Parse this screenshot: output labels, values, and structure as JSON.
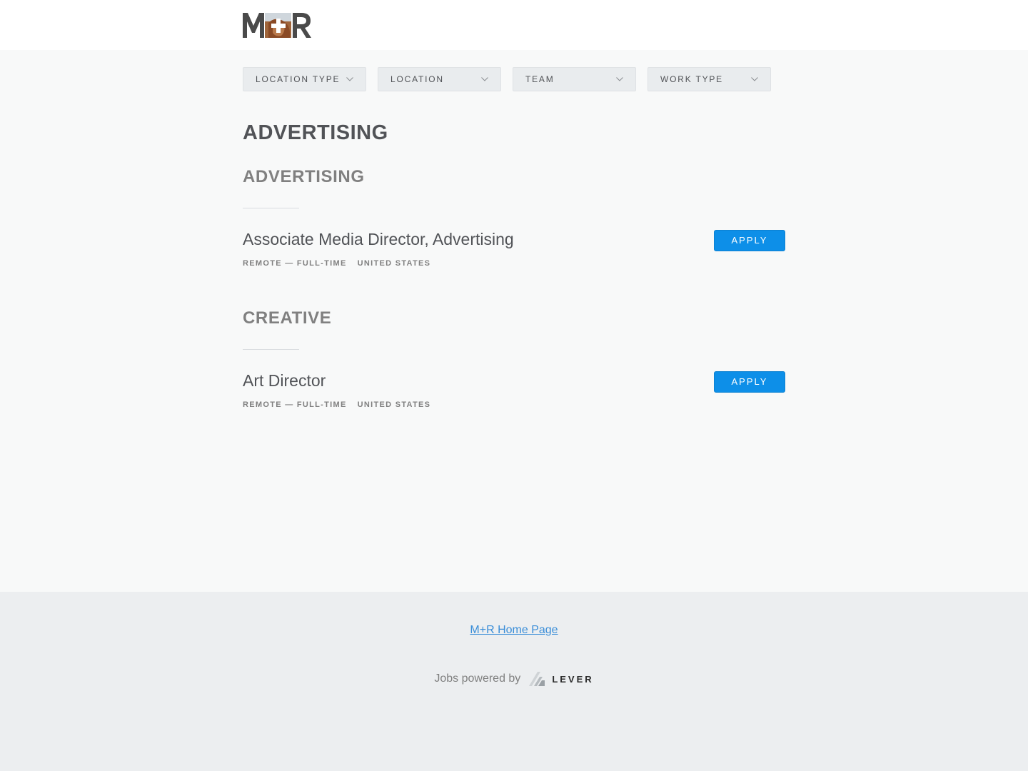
{
  "header": {
    "logo_text": "M+R"
  },
  "filters": [
    {
      "label": "LOCATION TYPE",
      "icon": "chevron-down-icon"
    },
    {
      "label": "LOCATION",
      "icon": "chevron-down-icon"
    },
    {
      "label": "TEAM",
      "icon": "chevron-down-icon"
    },
    {
      "label": "WORK TYPE",
      "icon": "chevron-down-icon"
    }
  ],
  "department": {
    "title": "ADVERTISING"
  },
  "groups": [
    {
      "title": "ADVERTISING",
      "postings": [
        {
          "title": "Associate Media Director, Advertising",
          "commitment": "REMOTE — FULL-TIME",
          "location": "UNITED STATES",
          "apply_label": "APPLY"
        }
      ]
    },
    {
      "title": "CREATIVE",
      "postings": [
        {
          "title": "Art Director",
          "commitment": "REMOTE — FULL-TIME",
          "location": "UNITED STATES",
          "apply_label": "APPLY"
        }
      ]
    }
  ],
  "footer": {
    "home_link": "M+R Home Page",
    "powered_by": "Jobs powered by",
    "lever_brand": "LEVER"
  },
  "colors": {
    "apply_button": "#0d8fe8",
    "link": "#3b8ed8",
    "page_bg": "#f8f9f9",
    "footer_bg": "#eceef0"
  }
}
